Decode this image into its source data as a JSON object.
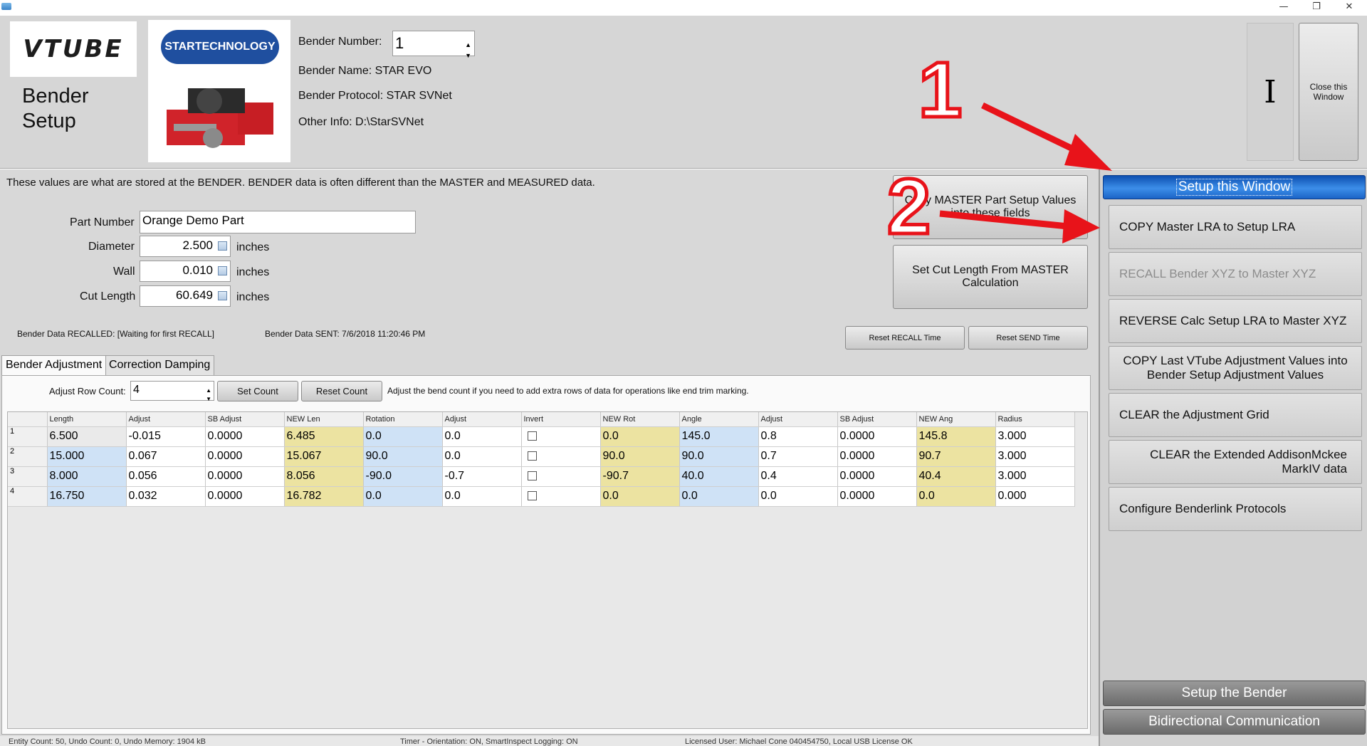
{
  "window": {
    "minimize": "—",
    "restore": "❐",
    "close": "✕"
  },
  "header": {
    "logo_text": "VTUBE",
    "title_line1": "Bender",
    "title_line2": "Setup",
    "startech_logo": "STARTECHNOLOGY",
    "bender_number_label": "Bender Number:",
    "bender_number_value": "1",
    "bender_name": "Bender Name:  STAR EVO",
    "bender_protocol": "Bender Protocol:  STAR SVNet",
    "other_info": "Other Info:  D:\\StarSVNet",
    "cursor_glyph": "I",
    "close_window_label": "Close this Window"
  },
  "main": {
    "info_text": "These values are what are stored at the BENDER.  BENDER data is often different than the MASTER and MEASURED data.",
    "part_number_label": "Part Number",
    "part_number_value": "Orange Demo Part",
    "diameter_label": "Diameter",
    "diameter_value": "2.500",
    "wall_label": "Wall",
    "wall_value": "0.010",
    "cut_length_label": "Cut Length",
    "cut_length_value": "60.649",
    "unit": "inches",
    "copy_master_setup_btn": "Copy MASTER Part Setup Values into these fields",
    "set_cut_length_btn": "Set Cut Length From MASTER Calculation",
    "recalled_status": "Bender Data RECALLED:  [Waiting for first RECALL]",
    "sent_status": "Bender Data SENT:  7/6/2018 11:20:46 PM",
    "reset_recall_btn": "Reset RECALL Time",
    "reset_send_btn": "Reset SEND Time",
    "tabs": [
      "Bender Adjustment",
      "Correction Damping"
    ],
    "row_count_label": "Adjust Row Count:",
    "row_count_value": "4",
    "set_count_btn": "Set Count",
    "reset_count_btn": "Reset Count",
    "row_count_hint": "Adjust the bend count if you need to add extra rows of data for operations like end trim marking."
  },
  "grid": {
    "columns": [
      "Length",
      "Adjust",
      "SB Adjust",
      "NEW Len",
      "Rotation",
      "Adjust",
      "Invert",
      "NEW Rot",
      "Angle",
      "Adjust",
      "SB Adjust",
      "NEW Ang",
      "Radius"
    ],
    "rows": [
      {
        "no": "1",
        "cells": [
          "6.500",
          "-0.015",
          "0.0000",
          "6.485",
          "0.0",
          "0.0",
          "",
          "0.0",
          "145.0",
          "0.8",
          "0.0000",
          "145.8",
          "3.000"
        ]
      },
      {
        "no": "2",
        "cells": [
          "15.000",
          "0.067",
          "0.0000",
          "15.067",
          "90.0",
          "0.0",
          "",
          "90.0",
          "90.0",
          "0.7",
          "0.0000",
          "90.7",
          "3.000"
        ]
      },
      {
        "no": "3",
        "cells": [
          "8.000",
          "0.056",
          "0.0000",
          "8.056",
          "-90.0",
          "-0.7",
          "",
          "-90.7",
          "40.0",
          "0.4",
          "0.0000",
          "40.4",
          "3.000"
        ]
      },
      {
        "no": "4",
        "cells": [
          "16.750",
          "0.032",
          "0.0000",
          "16.782",
          "0.0",
          "0.0",
          "",
          "0.0",
          "0.0",
          "0.0",
          "0.0000",
          "0.0",
          "0.000"
        ]
      }
    ]
  },
  "right_panel": {
    "header": "Setup this Window",
    "buttons": [
      "COPY Master LRA to Setup LRA",
      "RECALL Bender XYZ to Master XYZ",
      "REVERSE Calc Setup LRA to Master XYZ",
      "COPY Last VTube Adjustment Values into Bender Setup Adjustment Values",
      "CLEAR the Adjustment Grid",
      "CLEAR the Extended AddisonMckee MarkIV data",
      "Configure Benderlink Protocols"
    ],
    "setup_bender": "Setup the Bender",
    "bidirectional": "Bidirectional Communication"
  },
  "status_bar": {
    "left": "Entity Count: 50, Undo Count: 0, Undo Memory: 1904 kB",
    "mid": "Timer - Orientation: ON, SmartInspect Logging: ON",
    "right": "Licensed User: Michael Cone 040454750, Local USB License OK"
  },
  "annotations": {
    "one": "1",
    "two": "2"
  },
  "colors": {
    "accent_blue": "#1b63c6",
    "highlight_blue": "#cfe2f6",
    "highlight_yellow": "#ece3a1",
    "arrow_red": "#e8131a"
  }
}
